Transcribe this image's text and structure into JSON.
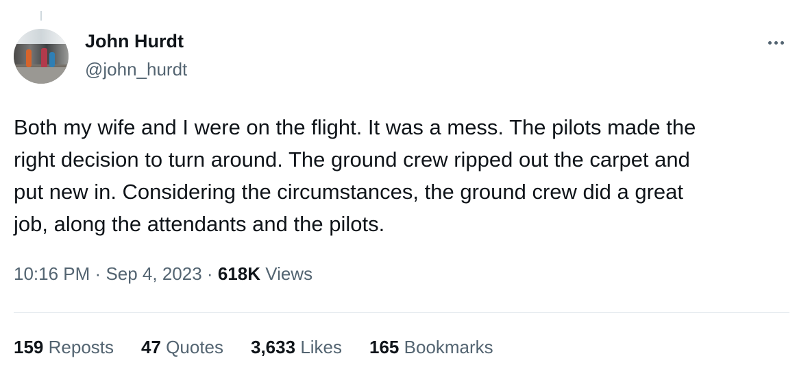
{
  "tweet": {
    "author": {
      "display_name": "John Hurdt",
      "handle": "@john_hurdt"
    },
    "text_lines": [
      "Both my wife and I were on the flight. It was a mess. The pilots made the",
      "right decision to turn around. The ground crew ripped out the carpet and",
      "put new in. Considering the circumstances, the ground crew did a great",
      "job, along the attendants and the pilots."
    ],
    "time": "10:16 PM",
    "date": "Sep 4, 2023",
    "separator": "·",
    "views_count": "618K",
    "views_label": "Views",
    "stats": [
      {
        "count": "159",
        "label": "Reposts"
      },
      {
        "count": "47",
        "label": "Quotes"
      },
      {
        "count": "3,633",
        "label": "Likes"
      },
      {
        "count": "165",
        "label": "Bookmarks"
      }
    ],
    "more_icon": "more-horizontal-icon"
  }
}
